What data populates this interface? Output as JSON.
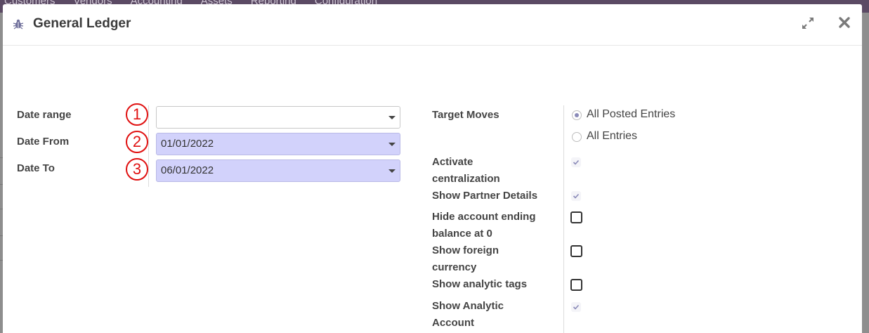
{
  "background": {
    "nav_items": [
      "Customers",
      "Vendors",
      "Accounting",
      "Assets",
      "Reporting",
      "Configuration"
    ]
  },
  "modal": {
    "title": "General Ledger",
    "icons": {
      "title_icon": "bug-icon",
      "expand": "expand-icon",
      "close": "close-icon"
    }
  },
  "form": {
    "date_range": {
      "label": "Date range",
      "value": "",
      "marker": "1"
    },
    "date_from": {
      "label": "Date From",
      "value": "01/01/2022",
      "marker": "2"
    },
    "date_to": {
      "label": "Date To",
      "value": "06/01/2022",
      "marker": "3"
    },
    "target_moves": {
      "label": "Target Moves",
      "options": [
        {
          "label": "All Posted Entries",
          "selected": true
        },
        {
          "label": "All Entries",
          "selected": false
        }
      ]
    },
    "activate_centralization": {
      "label_line1": "Activate",
      "label_line2": "centralization",
      "checked": true
    },
    "show_partner_details": {
      "label": "Show Partner Details",
      "checked": true
    },
    "hide_account_ending_balance": {
      "label_line1": "Hide account ending",
      "label_line2": "balance at 0",
      "checked": false
    },
    "show_foreign_currency": {
      "label_line1": "Show foreign",
      "label_line2": "currency",
      "checked": false
    },
    "show_analytic_tags": {
      "label": "Show analytic tags",
      "checked": false
    },
    "show_analytic_account": {
      "label_line1": "Show Analytic",
      "label_line2": "Account",
      "checked": true
    }
  },
  "colors": {
    "filled_field": "#d2d2fb",
    "marker": "#e01010",
    "accent": "#8a8ab8"
  }
}
